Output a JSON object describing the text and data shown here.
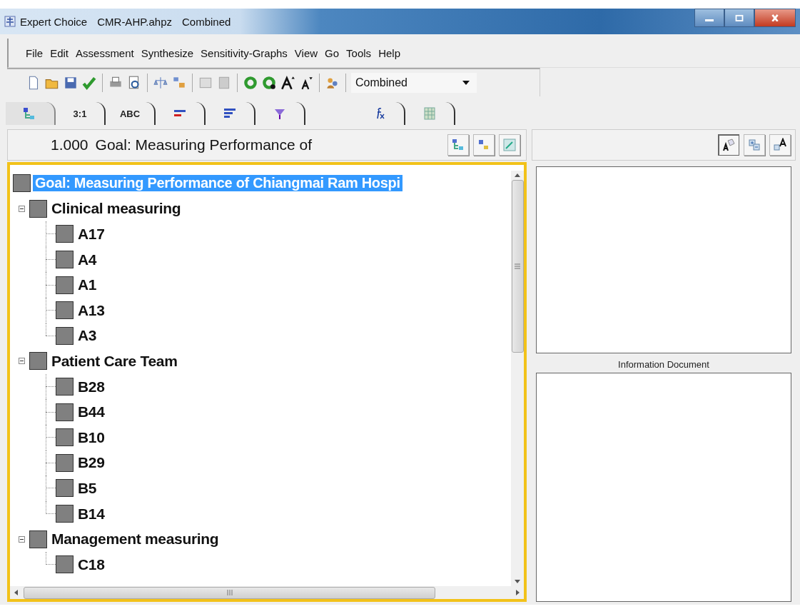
{
  "window": {
    "title_parts": [
      "Expert Choice",
      "CMR-AHP.ahpz",
      "Combined"
    ]
  },
  "menu": [
    "File",
    "Edit",
    "Assessment",
    "Synthesize",
    "Sensitivity-Graphs",
    "View",
    "Go",
    "Tools",
    "Help"
  ],
  "toolbar": {
    "mode_dropdown": {
      "value": "Combined"
    }
  },
  "tabs": [
    {
      "selected": true
    },
    {
      "label": "3:1",
      "selected": false
    },
    {
      "label": "ABC",
      "selected": false
    },
    {
      "selected": false
    },
    {
      "selected": false
    },
    {
      "selected": false
    },
    {
      "selected": false
    },
    {
      "selected": false
    }
  ],
  "node_header": {
    "priority": "1.000",
    "label": "Goal: Measuring Performance of"
  },
  "tree": [
    {
      "label": "Goal: Measuring Performance of Chiangmai Ram Hospi",
      "selected": true,
      "children": [
        {
          "label": "Clinical measuring",
          "selected": false,
          "expanded": true,
          "children": [
            {
              "label": "A17",
              "selected": false
            },
            {
              "label": "A4",
              "selected": false
            },
            {
              "label": "A1",
              "selected": false
            },
            {
              "label": "A13",
              "selected": false
            },
            {
              "label": "A3",
              "selected": false
            }
          ]
        },
        {
          "label": "Patient Care Team",
          "selected": false,
          "expanded": true,
          "children": [
            {
              "label": "B28",
              "selected": false
            },
            {
              "label": "B44",
              "selected": false
            },
            {
              "label": "B10",
              "selected": false
            },
            {
              "label": "B29",
              "selected": false
            },
            {
              "label": "B5",
              "selected": false
            },
            {
              "label": "B14",
              "selected": false
            }
          ]
        },
        {
          "label": "Management measuring",
          "selected": false,
          "expanded": true,
          "children": [
            {
              "label": "C18",
              "selected": false
            }
          ]
        }
      ]
    }
  ],
  "info_panel": {
    "caption": "Information Document"
  }
}
